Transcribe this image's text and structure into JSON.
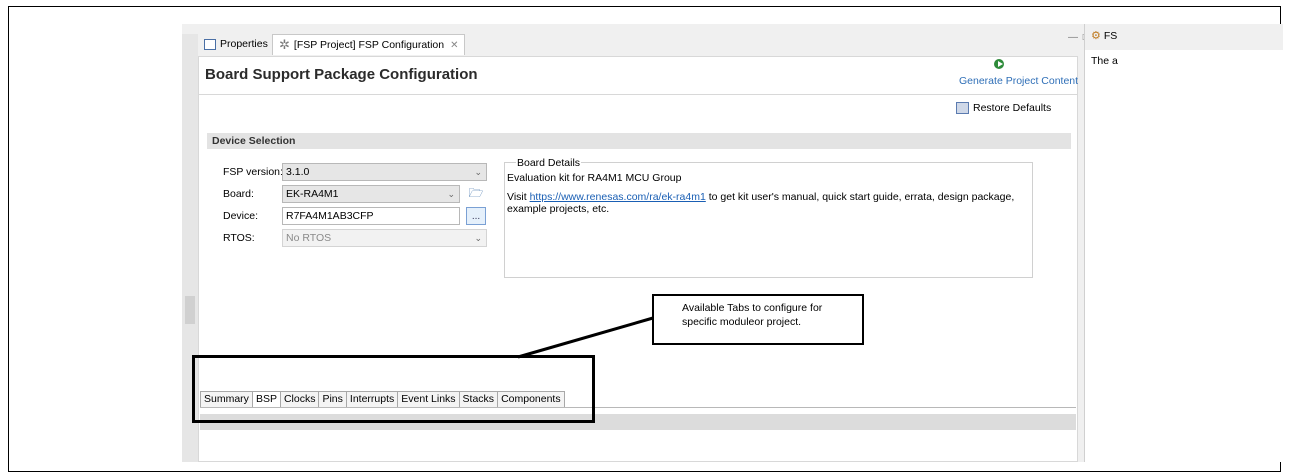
{
  "tabs": {
    "properties": "Properties",
    "fsp_config": "[FSP Project] FSP Configuration",
    "close_glyph": "✕"
  },
  "window_controls": "— □",
  "editor": {
    "title": "Board Support Package Configuration",
    "generate_label": "Generate Project Content",
    "restore_label": "Restore Defaults"
  },
  "device_selection": {
    "header": "Device Selection",
    "fsp_version_label": "FSP version:",
    "fsp_version_value": "3.1.0",
    "board_label": "Board:",
    "board_value": "EK-RA4M1",
    "device_label": "Device:",
    "device_value": "R7FA4M1AB3CFP",
    "browse_label": "...",
    "rtos_label": "RTOS:",
    "rtos_value": "No RTOS"
  },
  "board_details": {
    "legend": "Board Details",
    "description": "Evaluation kit for RA4M1 MCU Group",
    "visit_prefix": "Visit ",
    "link_text": "https://www.renesas.com/ra/ek-ra4m1",
    "visit_suffix": " to get kit user's manual, quick start guide, errata, design package, example projects, etc."
  },
  "bottom_tabs": [
    "Summary",
    "BSP",
    "Clocks",
    "Pins",
    "Interrupts",
    "Event Links",
    "Stacks",
    "Components"
  ],
  "active_bottom_tab": "BSP",
  "right_pane": {
    "tab_label": "FS",
    "text": "The a"
  },
  "callout": {
    "line1": "Available Tabs to configure for",
    "line2": "specific moduleor project."
  },
  "colors": {
    "link": "#1a5fb4",
    "generate_icon": "#2e8b3a",
    "annotation": "#000000"
  }
}
